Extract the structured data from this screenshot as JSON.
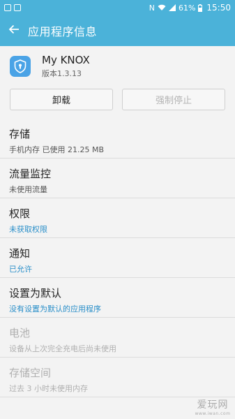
{
  "status_bar": {
    "nfc_glyph": "N",
    "battery_percent": "61%",
    "time": "15:50"
  },
  "app_bar": {
    "title": "应用程序信息",
    "back_icon": "arrow-left-icon"
  },
  "app": {
    "name": "My KNOX",
    "version": "版本1.3.13",
    "icon": "shield-keyhole-icon"
  },
  "buttons": {
    "uninstall": "卸载",
    "force_stop": "强制停止"
  },
  "items": [
    {
      "title": "存储",
      "subtitle": "手机内存 已使用 21.25 MB"
    },
    {
      "title": "流量监控",
      "subtitle": "未使用流量"
    },
    {
      "title": "权限",
      "subtitle": "未获取权限"
    },
    {
      "title": "通知",
      "subtitle": "已允许"
    },
    {
      "title": "设置为默认",
      "subtitle": "没有设置为默认的应用程序"
    },
    {
      "title": "电池",
      "subtitle": "设备从上次完全充电后尚未使用"
    },
    {
      "title": "存储空间",
      "subtitle": "过去 3 小时未使用内存"
    }
  ],
  "watermark": {
    "main": "爱玩网",
    "sub": "www.iwan.com"
  },
  "colors": {
    "accent": "#4bb2d9",
    "link": "#2a8fc9",
    "app_icon": "#4aa3e6"
  }
}
